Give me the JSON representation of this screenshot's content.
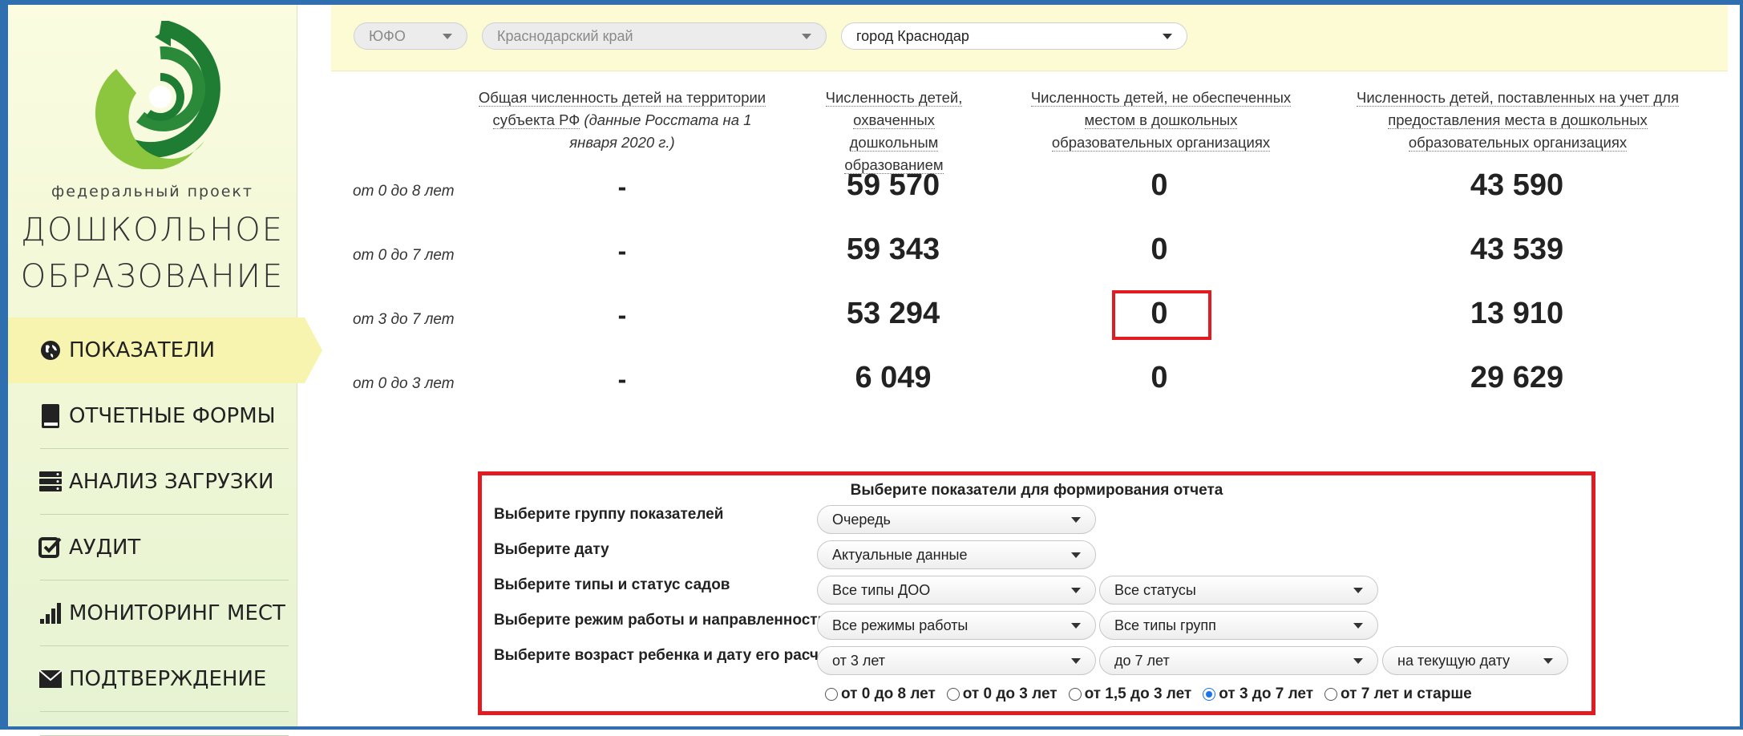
{
  "sidebar": {
    "project_small": "федеральный проект",
    "project_line1": "ДОШКОЛЬНОЕ",
    "project_line2": "ОБРАЗОВАНИЕ",
    "brand_colors": {
      "dark_green": "#1e7d32",
      "light_green": "#8cc63f"
    },
    "items": [
      {
        "label": "ПОКАЗАТЕЛИ",
        "icon": "globe-icon",
        "active": true
      },
      {
        "label": "ОТЧЕТНЫЕ ФОРМЫ",
        "icon": "book-icon",
        "active": false
      },
      {
        "label": "АНАЛИЗ ЗАГРУЗКИ",
        "icon": "server-icon",
        "active": false
      },
      {
        "label": "АУДИТ",
        "icon": "checkbox-icon",
        "active": false
      },
      {
        "label": "МОНИТОРИНГ МЕСТ",
        "icon": "bar-chart-icon",
        "active": false
      },
      {
        "label": "ПОДТВЕРЖДЕНИЕ",
        "icon": "envelope-icon",
        "active": false
      }
    ]
  },
  "filters": {
    "district": "ЮФО",
    "region": "Краснодарский край",
    "city": "город Краснодар"
  },
  "table": {
    "headers": {
      "col1_main": "Общая численность детей на территории субъекта РФ",
      "col1_italic": "(данные Росстата на 1 января 2020 г.)",
      "col2": "Численность детей, охваченных дошкольным образованием",
      "col3": "Численность детей, не обеспеченных местом в дошкольных образовательных организациях",
      "col4": "Численность детей, поставленных на учет для предоставления места в дошкольных образовательных организациях"
    },
    "rows": [
      {
        "label": "от 0 до 8 лет",
        "c1": "-",
        "c2": "59 570",
        "c3": "0",
        "c4": "43 590"
      },
      {
        "label": "от 0 до 7 лет",
        "c1": "-",
        "c2": "59 343",
        "c3": "0",
        "c4": "43 539"
      },
      {
        "label": "от 3 до 7 лет",
        "c1": "-",
        "c2": "53 294",
        "c3": "0",
        "c4": "13 910"
      },
      {
        "label": "от 0 до 3 лет",
        "c1": "-",
        "c2": "6 049",
        "c3": "0",
        "c4": "29 629"
      }
    ]
  },
  "report": {
    "title": "Выберите показатели для формирования отчета",
    "labels": {
      "group": "Выберите группу показателей",
      "date": "Выберите дату",
      "types": "Выберите типы и статус садов",
      "mode": "Выберите режим работы и направленность",
      "age": "Выберите возраст ребенка и дату его расчета"
    },
    "selects": {
      "group": "Очередь",
      "date": "Актуальные данные",
      "types": "Все типы ДОО",
      "status": "Все статусы",
      "mode": "Все режимы работы",
      "groups": "Все типы групп",
      "age_from": "от 3 лет",
      "age_to": "до 7 лет",
      "calc_date": "на текущую дату"
    },
    "radios": [
      {
        "label": "от 0 до 8 лет",
        "checked": false
      },
      {
        "label": "от 0 до 3 лет",
        "checked": false
      },
      {
        "label": "от 1,5 до 3 лет",
        "checked": false
      },
      {
        "label": "от 3 до 7 лет",
        "checked": true
      },
      {
        "label": "от 7 лет и старше",
        "checked": false
      }
    ]
  }
}
